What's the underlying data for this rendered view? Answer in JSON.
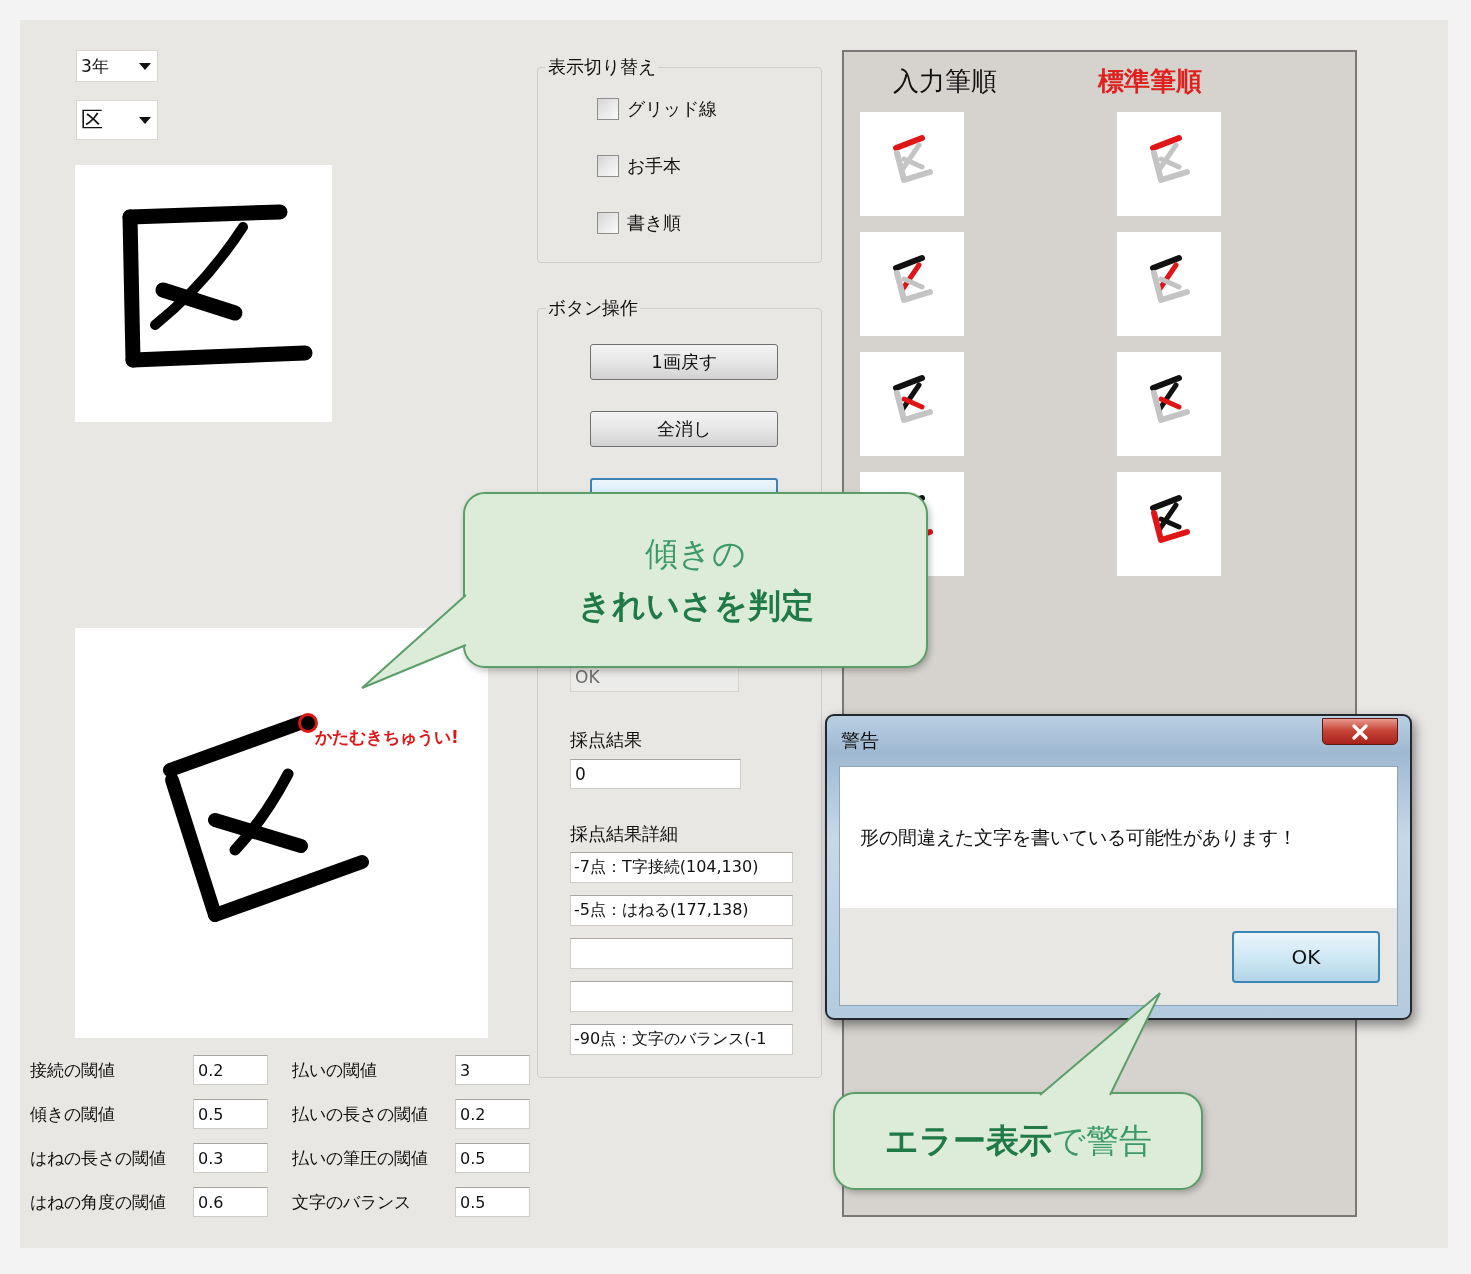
{
  "grade_select": {
    "value": "3年"
  },
  "kanji_select": {
    "value": "区"
  },
  "canvas_annotation": {
    "text": "かたむきちゅうい!"
  },
  "thresholds": [
    {
      "label": "接続の閾値",
      "value": "0.2"
    },
    {
      "label": "払いの閾値",
      "value": "3"
    },
    {
      "label": "傾きの閾値",
      "value": "0.5"
    },
    {
      "label": "払いの長さの閾値",
      "value": "0.2"
    },
    {
      "label": "はねの長さの閾値",
      "value": "0.3"
    },
    {
      "label": "払いの筆圧の閾値",
      "value": "0.5"
    },
    {
      "label": "はねの角度の閾値",
      "value": "0.6"
    },
    {
      "label": "文字のバランス",
      "value": "0.5"
    }
  ],
  "display_group": {
    "title": "表示切り替え",
    "options": [
      {
        "label": "グリッド線",
        "checked": false
      },
      {
        "label": "お手本",
        "checked": false
      },
      {
        "label": "書き順",
        "checked": false
      }
    ]
  },
  "button_group": {
    "title": "ボタン操作",
    "buttons": [
      {
        "label": "1画戻す",
        "focused": false
      },
      {
        "label": "全消し",
        "focused": false
      },
      {
        "focused": true
      }
    ],
    "judgement_field": {
      "value": "OK",
      "disabled": true
    },
    "score_label": "採点結果",
    "score_value": "0",
    "details_label": "採点結果詳細",
    "details": [
      {
        "kind": "filled",
        "text": "-7点：T字接続(104,130)"
      },
      {
        "kind": "filled",
        "text": "-5点：はねる(177,138)"
      },
      {
        "kind": "empty"
      },
      {
        "kind": "empty"
      },
      {
        "kind": "filled",
        "text": "-90点：文字のバランス(-1"
      }
    ]
  },
  "stroke_order": {
    "input_title": "入力筆順",
    "standard_title": "標準筆順"
  },
  "dialog": {
    "title": "警告",
    "message": "形の間違えた文字を書いている可能性があります！",
    "buttons": [
      "OK"
    ]
  },
  "callouts": [
    {
      "lines": [
        {
          "text": "傾きの",
          "bold": false
        },
        {
          "text": "きれいさを判定",
          "bold": true
        }
      ]
    },
    {
      "lines": [
        {
          "text": "**エラー表示**で警告",
          "bold": false
        }
      ]
    }
  ]
}
